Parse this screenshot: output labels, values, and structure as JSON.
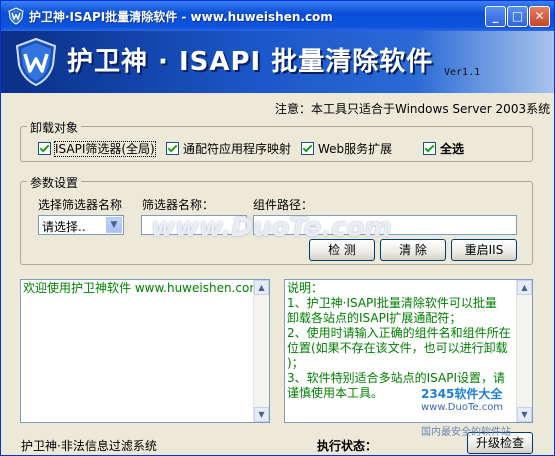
{
  "window": {
    "title": "护卫神·ISAPI批量清除软件 - www.huweishen.com",
    "minimize_glyph": "_",
    "maximize_glyph": "□",
    "close_glyph": "✕"
  },
  "banner": {
    "title": "护卫神 · ISAPI 批量清除软件",
    "version": "Ver1.1"
  },
  "notice": "注意：本工具只适合于Windows Server 2003系统",
  "uninstall_group": {
    "legend": "卸载对象",
    "options": [
      {
        "label": "ISAPI筛选器(全局)",
        "checked": true
      },
      {
        "label": "通配符应用程序映射",
        "checked": true
      },
      {
        "label": "Web服务扩展",
        "checked": true
      },
      {
        "label": "全选",
        "checked": true
      }
    ]
  },
  "params_group": {
    "legend": "参数设置",
    "select_label": "选择筛选器名称",
    "select_value": "请选择..",
    "filter_name_label": "筛选器名称：",
    "component_path_label": "组件路径：",
    "filter_name_value": "",
    "component_path_value": ""
  },
  "buttons": {
    "detect": "检 测",
    "clear": "清 除",
    "restart_iis": "重启IIS",
    "upgrade": "升级检查"
  },
  "log_panel": {
    "text": "欢迎使用护卫神软件   www.huweishen.com"
  },
  "help_panel": {
    "lines": [
      "说明：",
      "1、护卫神·ISAPI批量清除软件可以批量",
      "卸载各站点的ISAPI扩展通配符；",
      "2、使用时请输入正确的组件名和组件所在",
      "位置(如果不存在该文件，也可以进行卸载",
      ")；",
      "3、软件特别适合多站点的ISAPI设置，请",
      "谨慎使用本工具。"
    ]
  },
  "status": {
    "left": "护卫神·非法信息过滤系统",
    "exec_label": "执行状态："
  },
  "watermarks": {
    "site": "www.DuoTe.com",
    "brand": "2345软件大全",
    "brand_url": "www.DuoTe.com",
    "slogan": "国内最安全的软件站"
  },
  "colors": {
    "title_bar": "#0a4fd6",
    "banner": "#1b56c8",
    "log_text": "#008000"
  }
}
